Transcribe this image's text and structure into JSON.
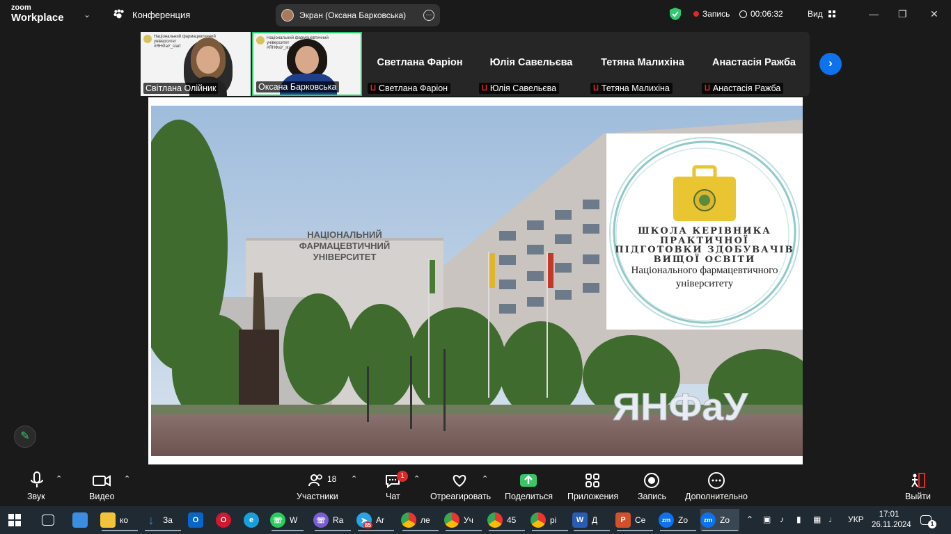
{
  "app": {
    "brand_line1": "zoom",
    "brand_line2": "Workplace",
    "meeting_label": "Конференция"
  },
  "screen_share": {
    "label": "Экран (Оксана Барковська)"
  },
  "status": {
    "recording_label": "Запись",
    "timer": "00:06:32",
    "view_label": "Вид"
  },
  "participants_strip": {
    "video_tiles": [
      {
        "name": "Світлана Олійник",
        "slide_text": "Національний фармацевтичний університет",
        "slide_tag": "#ЯНФаУ_start"
      },
      {
        "name": "Оксана Барковська",
        "slide_text": "Національний фармацевтичний університет",
        "slide_tag": "#ЯНФаУ_start",
        "active_speaker": true
      }
    ],
    "blank_tiles": [
      {
        "name_big": "Светлана Фаріон",
        "name_small": "Светлана Фаріон",
        "muted": true
      },
      {
        "name_big": "Юлія Савельєва",
        "name_small": "Юлія Савельєва",
        "muted": true
      },
      {
        "name_big": "Тетяна Малихіна",
        "name_small": "Тетяна Малихіна",
        "muted": true
      },
      {
        "name_big": "Анастасія Ражба",
        "name_small": "Анастасія Ражба",
        "muted": true
      }
    ]
  },
  "slide": {
    "building_sign": [
      "НАЦІОНАЛЬНИЙ",
      "ФАРМАЦЕВТИЧНИЙ",
      "УНІВЕРСИТЕТ"
    ],
    "letters_sign": "ЯНФаУ",
    "badge_title": [
      "ШКОЛА КЕРІВНИКА",
      "ПРАКТИЧНОЇ",
      "ПІДГОТОВКИ ЗДОБУВАЧІВ",
      "ВИЩОЇ ОСВІТИ"
    ],
    "badge_subtitle": [
      "Національного фармацевтичного",
      "університету"
    ]
  },
  "toolbar": {
    "audio": "Звук",
    "video": "Видео",
    "participants": "Участники",
    "participants_count": "18",
    "chat": "Чат",
    "chat_badge": "1",
    "react": "Отреагировать",
    "share": "Поделиться",
    "apps": "Приложения",
    "record": "Запись",
    "more": "Дополнительно",
    "leave": "Выйти"
  },
  "taskbar": {
    "items": [
      "ко",
      "За",
      "",
      "",
      "",
      "W",
      "Ra",
      "Ar",
      "ле",
      "Уч",
      "45",
      "рі",
      "Д",
      "Се",
      "Zo",
      "Zo"
    ],
    "telegram_badge": "85",
    "language": "УКР",
    "time": "17:01",
    "date": "26.11.2024",
    "notif_count": "1"
  },
  "colors": {
    "accent_blue": "#0e72ed",
    "active_green": "#2ecc71",
    "record_red": "#e02828",
    "share_green": "#3ac569",
    "gold": "#e8c531",
    "teal_ring": "#8fc9c9"
  }
}
